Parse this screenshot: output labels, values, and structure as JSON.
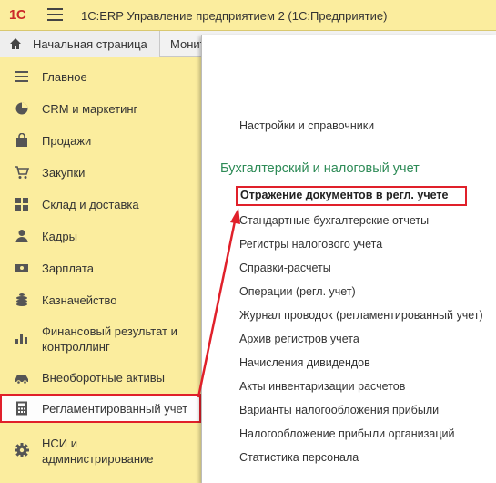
{
  "app": {
    "logo": "1С",
    "title": "1С:ERP Управление предприятием 2  (1С:Предприятие)"
  },
  "tabs": {
    "home": "Начальная страница",
    "monitor": "Монит"
  },
  "sidebar": {
    "items": [
      {
        "label": "Главное",
        "icon": "list-icon"
      },
      {
        "label": "CRM и маркетинг",
        "icon": "pie-chart-icon"
      },
      {
        "label": "Продажи",
        "icon": "shopping-bag-icon"
      },
      {
        "label": "Закупки",
        "icon": "cart-icon"
      },
      {
        "label": "Склад и доставка",
        "icon": "grid-icon"
      },
      {
        "label": "Кадры",
        "icon": "person-icon"
      },
      {
        "label": "Зарплата",
        "icon": "money-icon"
      },
      {
        "label": "Казначейство",
        "icon": "coins-icon"
      },
      {
        "label": "Финансовый результат и",
        "label2": "контроллинг",
        "icon": "bar-chart-icon"
      },
      {
        "label": "Внеоборотные активы",
        "icon": "car-icon"
      },
      {
        "label": "Регламентированный учет",
        "icon": "calculator-icon",
        "active": true
      },
      {
        "label": "НСИ и",
        "label2": "администрирование",
        "icon": "gear-icon"
      }
    ]
  },
  "content": {
    "settings_link": "Настройки и справочники",
    "section_title": "Бухгалтерский и налоговый учет",
    "highlighted_link": "Отражение документов в регл. учете",
    "links": [
      "Стандартные бухгалтерские отчеты",
      "Регистры налогового учета",
      "Справки-расчеты",
      "Операции (регл. учет)",
      "Журнал проводок (регламентированный учет)",
      "Архив регистров учета",
      "Начисления дивидендов",
      "Акты инвентаризации расчетов",
      "Варианты налогообложения прибыли",
      "Налогообложение прибыли организаций",
      "Статистика персонала"
    ]
  },
  "colors": {
    "sidebar_bg": "#fbed9e",
    "accent_red": "#e0202a",
    "section_green": "#2e8b57"
  }
}
